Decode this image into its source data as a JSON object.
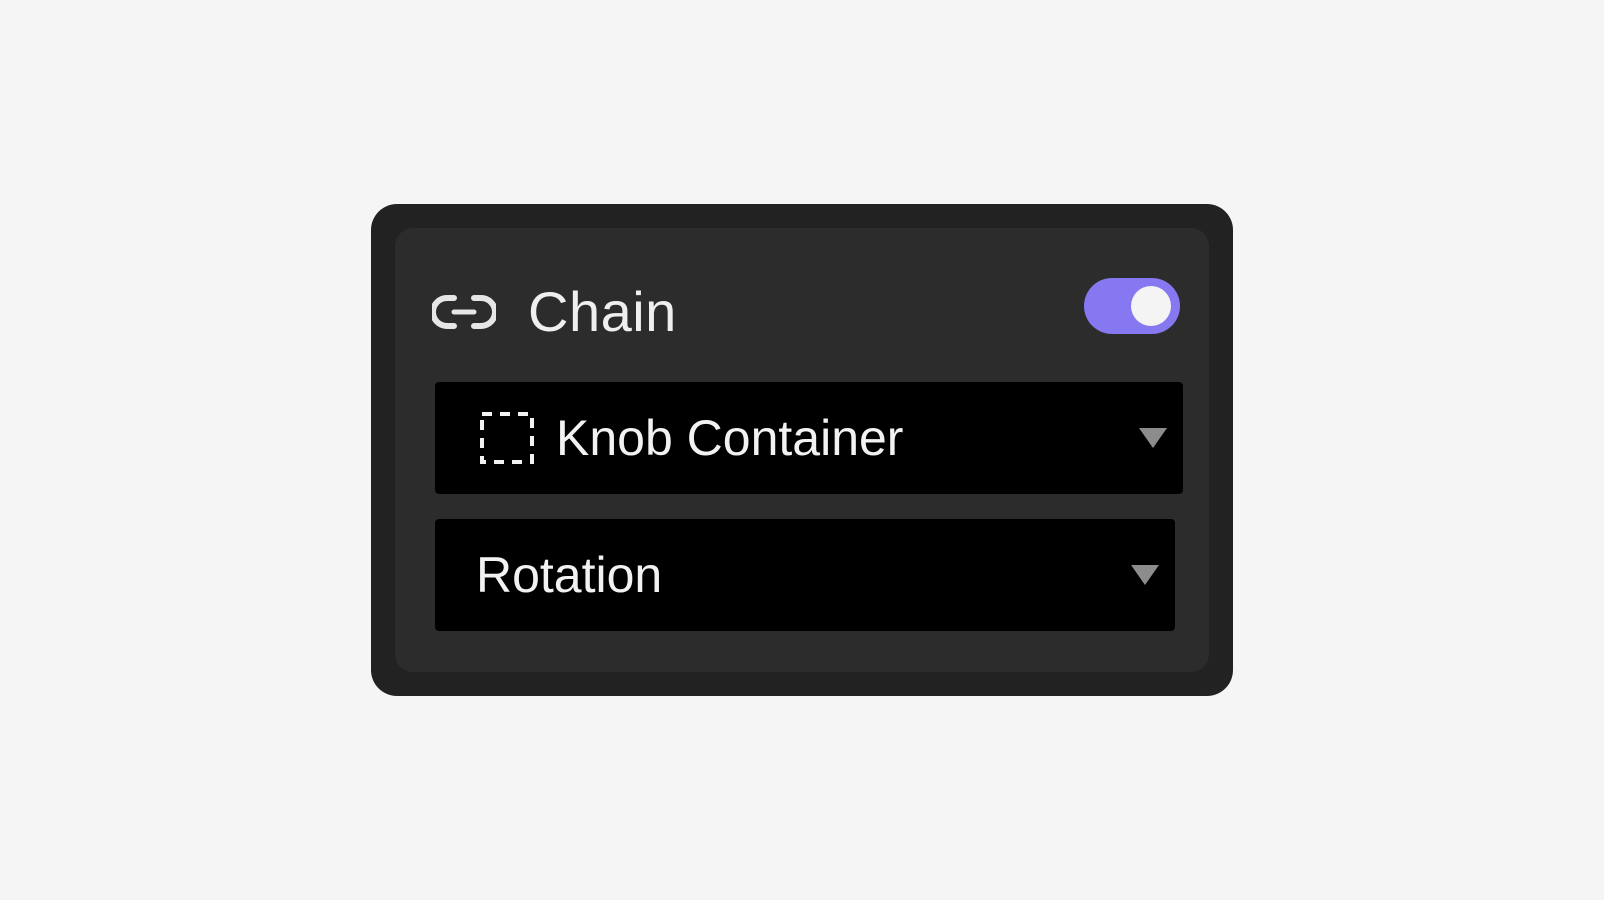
{
  "panel": {
    "title": "Chain",
    "title_icon": "chain-link-icon",
    "toggle": {
      "state": "on",
      "accent_color": "#8678f0"
    },
    "target_dropdown": {
      "icon": "dashed-container-icon",
      "selected": "Knob Container",
      "caret_icon": "caret-down-icon"
    },
    "property_dropdown": {
      "selected": "Rotation",
      "caret_icon": "caret-down-icon"
    }
  },
  "colors": {
    "page_background": "#f5f5f5",
    "panel_outer": "#222222",
    "panel_inner": "#2c2c2c",
    "field_background": "#000000",
    "text": "#efefef"
  }
}
